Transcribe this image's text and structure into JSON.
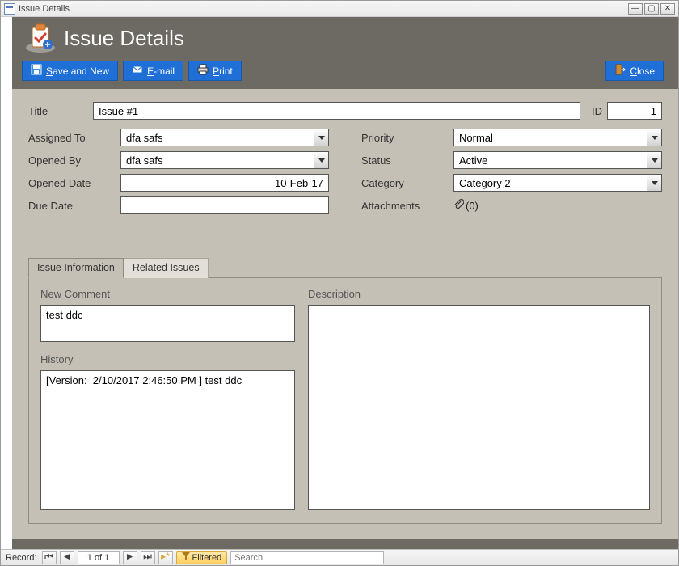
{
  "window": {
    "title": "Issue Details"
  },
  "header": {
    "title": "Issue Details"
  },
  "toolbar": {
    "saveNew_prefix": "S",
    "saveNew_rest": "ave and New",
    "email_prefix": "E",
    "email_rest": "-mail",
    "print_prefix": "P",
    "print_rest": "rint",
    "close_prefix": "C",
    "close_rest": "lose"
  },
  "fields": {
    "title_label": "Title",
    "title_value": "Issue #1",
    "id_label": "ID",
    "id_value": "1",
    "assignedTo_label": "Assigned To",
    "assignedTo_value": "dfa safs",
    "openedBy_label": "Opened By",
    "openedBy_value": "dfa safs",
    "openedDate_label": "Opened Date",
    "openedDate_value": "10-Feb-17",
    "dueDate_label": "Due Date",
    "dueDate_value": "",
    "priority_label": "Priority",
    "priority_value": "Normal",
    "status_label": "Status",
    "status_value": "Active",
    "category_label": "Category",
    "category_value": "Category 2",
    "attachments_label": "Attachments",
    "attachments_count": "(0)"
  },
  "tabs": {
    "info": "Issue Information",
    "related": "Related Issues"
  },
  "panel": {
    "newComment_label": "New Comment",
    "newComment_value": "test ddc",
    "history_label": "History",
    "history_value": "[Version:  2/10/2017 2:46:50 PM ] test ddc",
    "description_label": "Description",
    "description_value": ""
  },
  "statusbar": {
    "record_label": "Record:",
    "counter": "1 of 1",
    "filtered": "Filtered",
    "search_placeholder": "Search"
  }
}
